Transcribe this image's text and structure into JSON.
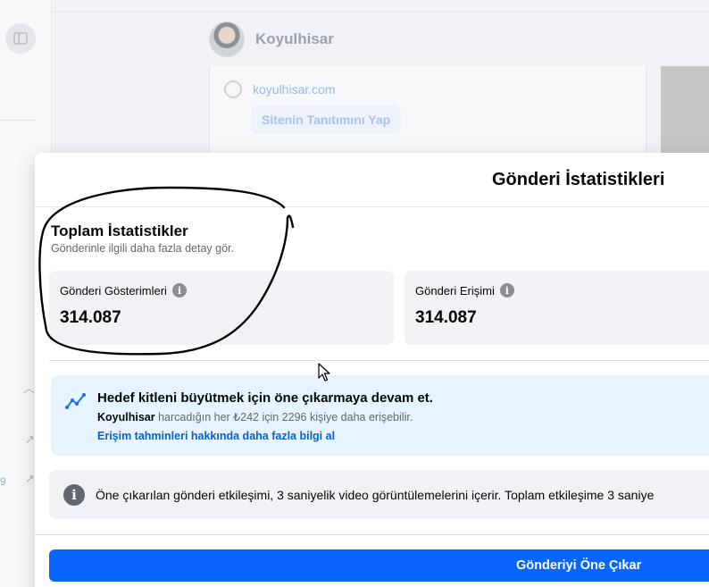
{
  "background": {
    "page_name": "Koyulhisar",
    "website": "koyulhisar.com",
    "promote_site_label": "Sitenin Tanıtımını Yap",
    "side_number": "9"
  },
  "modal": {
    "title": "Gönderi İstatistikleri",
    "section_title": "Toplam İstatistikler",
    "section_subtitle": "Gönderinle ilgili daha fazla detay gör.",
    "stats": [
      {
        "label": "Gönderi Gösterimleri",
        "value": "314.087",
        "icon": "info-icon"
      },
      {
        "label": "Gönderi Erişimi",
        "value": "314.087",
        "icon": "info-icon"
      }
    ],
    "boost": {
      "title": "Hedef kitleni büyütmek için öne çıkarmaya devam et.",
      "page_name": "Koyulhisar",
      "text": " harcadığın her ₺242 için 2296 kişiye daha erişebilir.",
      "link": "Erişim tahminleri hakkında daha fazla bilgi al",
      "icon": "trend-icon"
    },
    "note": {
      "text": "Öne çıkarılan gönderi etkileşimi, 3 saniyelik video görüntülemelerini içerir. Toplam etkileşime 3 saniye",
      "icon": "info-icon"
    },
    "cta_label": "Gönderiyi Öne Çıkar"
  },
  "colors": {
    "primary": "#0866ff",
    "link": "#0064d1",
    "boost_bg": "#e7f3ff",
    "card_bg": "#f0f2f5"
  }
}
